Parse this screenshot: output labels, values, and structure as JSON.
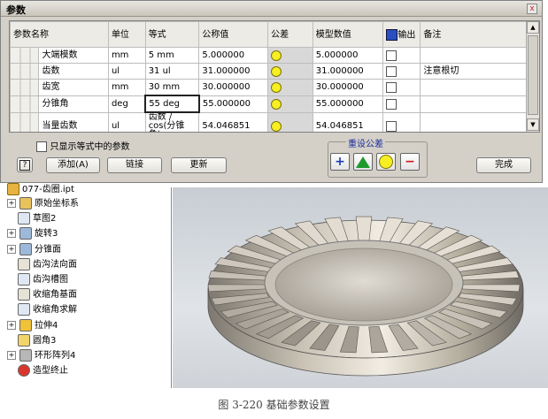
{
  "dialog": {
    "title": "参数",
    "close_label": "x",
    "columns": [
      "参数名称",
      "单位",
      "等式",
      "公称值",
      "公差",
      "模型数值",
      "输出",
      "备注"
    ],
    "rows": [
      {
        "name": "大端模数",
        "unit": "mm",
        "equation": "5 mm",
        "nominal": "5.000000",
        "model": "5.000000",
        "comment": ""
      },
      {
        "name": "齿数",
        "unit": "ul",
        "equation": "31 ul",
        "nominal": "31.000000",
        "model": "31.000000",
        "comment": "注意根切"
      },
      {
        "name": "齿宽",
        "unit": "mm",
        "equation": "30 mm",
        "nominal": "30.000000",
        "model": "30.000000",
        "comment": ""
      },
      {
        "name": "分锥角",
        "unit": "deg",
        "equation": "55 deg",
        "nominal": "55.000000",
        "model": "55.000000",
        "comment": ""
      },
      {
        "name": "当量齿数",
        "unit": "ul",
        "equation": "齿数 / cos(分锥角)",
        "nominal": "54.046851",
        "model": "54.046851",
        "comment": ""
      }
    ],
    "filter_label": "只显示等式中的参数",
    "help_label": "?",
    "add_label": "添加(A)",
    "link_label": "链接",
    "update_label": "更新",
    "tolerance_group_label": "重设公差",
    "tol_plus": "+",
    "tol_minus": "−",
    "done_label": "完成"
  },
  "tree": {
    "root": "077-齿圈.ipt",
    "items": [
      {
        "label": "原始坐标系",
        "icon": "folder-icon",
        "expand": "+"
      },
      {
        "label": "草图2",
        "icon": "sketch-icon",
        "expand": ""
      },
      {
        "label": "旋转3",
        "icon": "revolve-icon",
        "expand": "+"
      },
      {
        "label": "分锥面",
        "icon": "revolve-icon",
        "expand": "+"
      },
      {
        "label": "齿沟法向面",
        "icon": "workplane-icon",
        "expand": ""
      },
      {
        "label": "齿沟槽图",
        "icon": "sketch-icon",
        "expand": ""
      },
      {
        "label": "收缩角基面",
        "icon": "workplane-icon",
        "expand": ""
      },
      {
        "label": "收缩角求解",
        "icon": "sketch-icon",
        "expand": ""
      },
      {
        "label": "拉伸4",
        "icon": "extrude-icon",
        "expand": "+"
      },
      {
        "label": "圆角3",
        "icon": "fillet-icon",
        "expand": ""
      },
      {
        "label": "环形阵列4",
        "icon": "pattern-icon",
        "expand": "+"
      },
      {
        "label": "造型终止",
        "icon": "end-of-part-icon",
        "expand": ""
      }
    ]
  },
  "caption": "图 3-220  基础参数设置",
  "colors": {
    "accent": "#1a2d9a",
    "tolerance_dot": "#f7ef23",
    "dialog_bg": "#d4d0c8"
  }
}
